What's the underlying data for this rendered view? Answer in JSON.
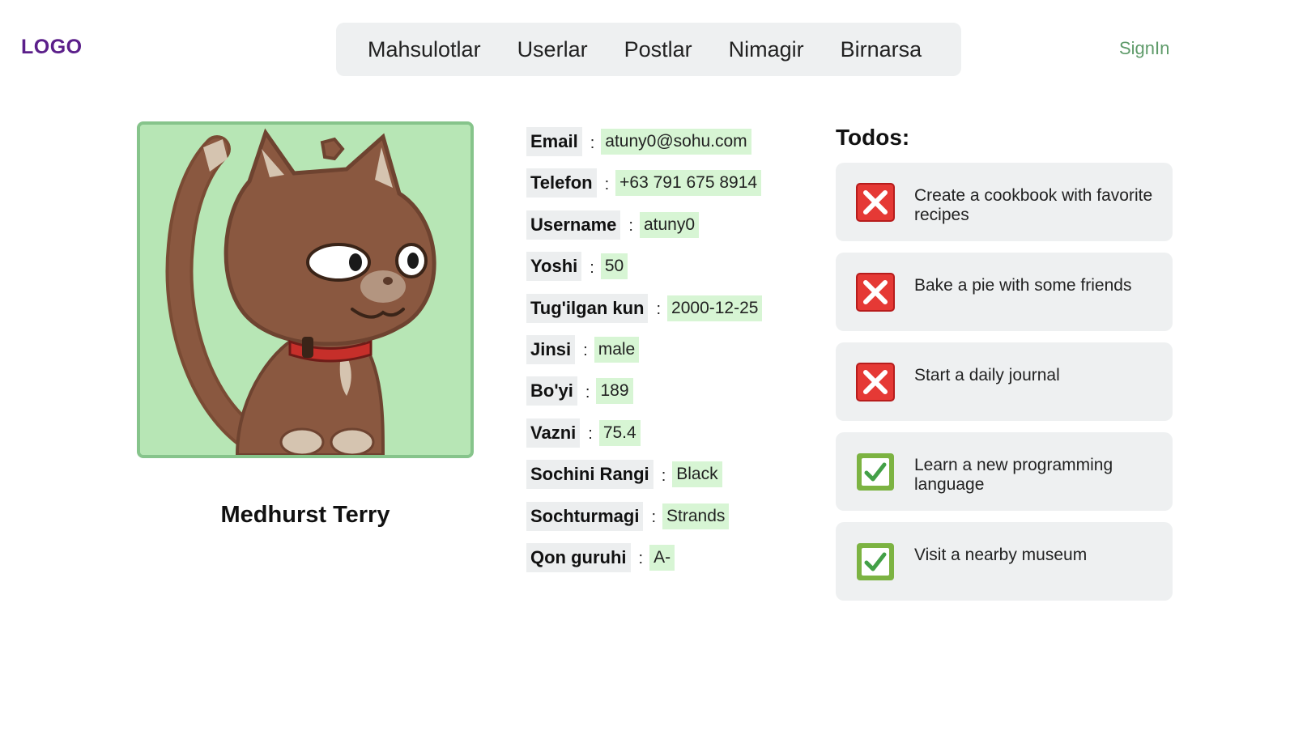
{
  "header": {
    "logo": "LOGO",
    "nav": [
      "Mahsulotlar",
      "Userlar",
      "Postlar",
      "Nimagir",
      "Birnarsa"
    ],
    "signin": "SignIn"
  },
  "profile": {
    "avatar_icon": "cat-avatar-icon",
    "name": "Medhurst Terry",
    "fields": [
      {
        "label": "Email",
        "value": "atuny0@sohu.com"
      },
      {
        "label": "Telefon",
        "value": "+63 791 675 8914"
      },
      {
        "label": "Username",
        "value": "atuny0"
      },
      {
        "label": "Yoshi",
        "value": "50"
      },
      {
        "label": "Tug'ilgan kun",
        "value": "2000-12-25"
      },
      {
        "label": "Jinsi",
        "value": "male"
      },
      {
        "label": "Bo'yi",
        "value": "189"
      },
      {
        "label": "Vazni",
        "value": "75.4"
      },
      {
        "label": "Sochini Rangi",
        "value": "Black"
      },
      {
        "label": "Sochturmagi",
        "value": "Strands"
      },
      {
        "label": "Qon guruhi",
        "value": "A-"
      }
    ],
    "separator": ":"
  },
  "todos": {
    "title": "Todos:",
    "items": [
      {
        "text": "Create a cookbook with favorite recipes",
        "completed": false,
        "icon": "cross-mark-icon"
      },
      {
        "text": "Bake a pie with some friends",
        "completed": false,
        "icon": "cross-mark-icon"
      },
      {
        "text": "Start a daily journal",
        "completed": false,
        "icon": "cross-mark-icon"
      },
      {
        "text": "Learn a new programming language",
        "completed": true,
        "icon": "check-mark-icon"
      },
      {
        "text": "Visit a nearby museum",
        "completed": true,
        "icon": "check-mark-icon"
      }
    ]
  },
  "colors": {
    "logo": "#5b1f8a",
    "signin": "#5f9b6a",
    "avatar_bg": "#b7e6b5",
    "value_bg": "#d7f5d4",
    "cross": "#e53935",
    "check": "#7cb342"
  }
}
